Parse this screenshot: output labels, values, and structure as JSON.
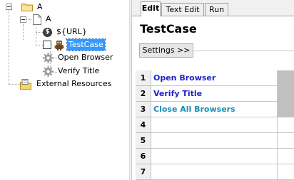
{
  "tree": {
    "root_label": "A",
    "suite_label": "A",
    "variable_label": "${URL}",
    "testcase_label": "TestCase",
    "keywords": [
      "Open Browser",
      "Verify Title"
    ],
    "resources_label": "External Resources"
  },
  "tabs": [
    {
      "label": "Edit",
      "active": true
    },
    {
      "label": "Text Edit",
      "active": false
    },
    {
      "label": "Run",
      "active": false
    }
  ],
  "editor": {
    "title": "TestCase",
    "settings_label": "Settings >>",
    "rows": [
      {
        "num": "1",
        "keyword": "Open Browser",
        "color": "#1f1fc8"
      },
      {
        "num": "2",
        "keyword": "Verify Title",
        "color": "#1f1fc8"
      },
      {
        "num": "3",
        "keyword": "Close All Browsers",
        "color": "#1a8cb4"
      },
      {
        "num": "4",
        "keyword": ""
      },
      {
        "num": "5",
        "keyword": ""
      },
      {
        "num": "6",
        "keyword": ""
      },
      {
        "num": "7",
        "keyword": ""
      }
    ]
  },
  "colors": {
    "selection": "#3399ff",
    "user_keyword": "#1f1fc8",
    "library_keyword": "#1a8cb4"
  },
  "icons": [
    "folder-icon",
    "page-icon",
    "variable-icon",
    "checkbox",
    "robot-icon",
    "gear-icon",
    "resources-icon"
  ]
}
